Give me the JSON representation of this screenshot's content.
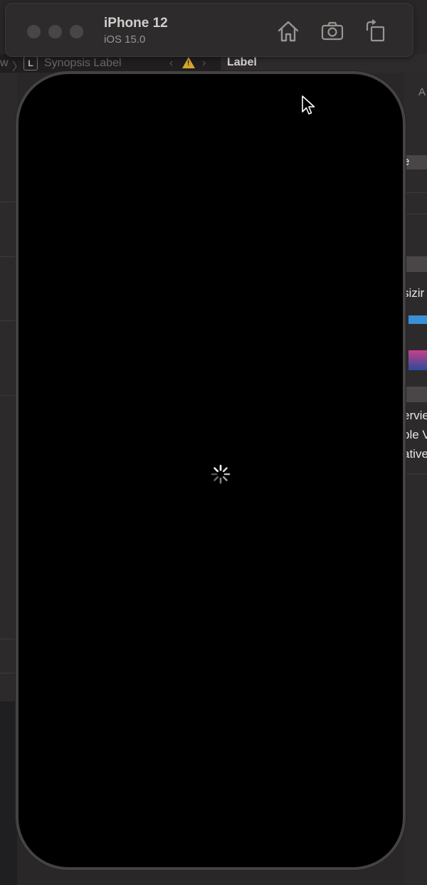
{
  "simulator": {
    "device_name": "iPhone 12",
    "os_version": "iOS 15.0",
    "toolbar": {
      "home_icon": "home-icon",
      "screenshot_icon": "camera-icon",
      "rotate_icon": "rotate-icon"
    },
    "screen_state": "loading",
    "spinner_icon": "activity-spinner-icon"
  },
  "xcode": {
    "breadcrumb": {
      "prev_segment": "w",
      "label_badge": "L",
      "current": "Synopsis Label"
    },
    "inspector": {
      "title": "Label",
      "partial_texts": {
        "a": "A",
        "e": "e",
        "sizing": "sizir",
        "overview": "ervie",
        "visible": "ble V",
        "relative": "ative"
      }
    }
  },
  "colors": {
    "background": "#2a2728",
    "screen": "#000000",
    "warning": "#d6a42a",
    "accent_blue": "#3b8fd6"
  }
}
